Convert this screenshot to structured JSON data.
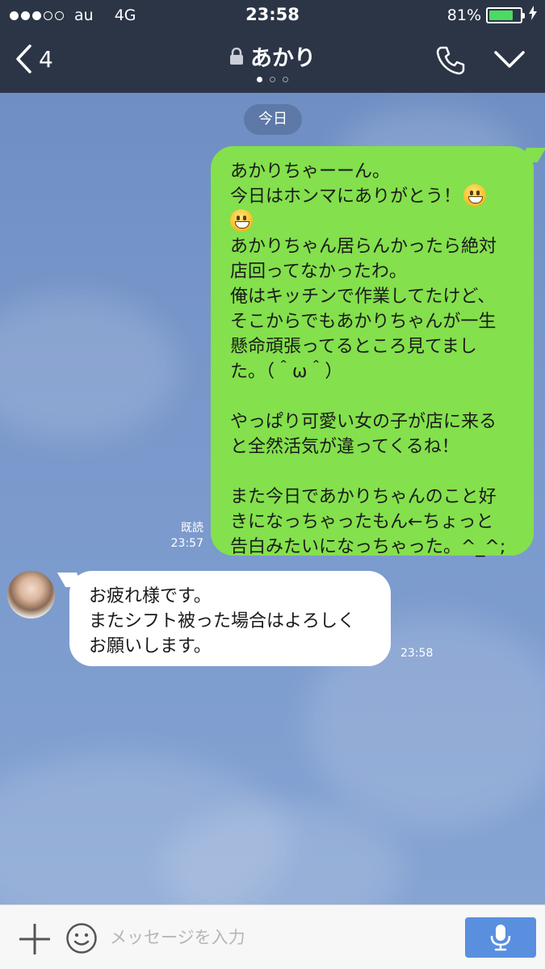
{
  "status_bar": {
    "carrier": "au",
    "network": "4G",
    "time": "23:58",
    "battery_percent": "81%",
    "battery_level": 0.81,
    "signal_dots_filled": 3,
    "signal_dots_total": 5
  },
  "nav": {
    "back_count": "4",
    "title": "あかり",
    "page_indicator_count": 3,
    "page_indicator_active": 1,
    "icons": [
      "chevron-left-icon",
      "lock-icon",
      "phone-icon",
      "chevron-down-icon"
    ]
  },
  "chat": {
    "date_label": "今日",
    "sent_message": {
      "lines": [
        "あかりちゃーーん。",
        "今日はホンマにありがとう！",
        "",
        "あかりちゃん居らんかったら絶対",
        "店回ってなかったわ。",
        "俺はキッチンで作業してたけど、",
        "そこからでもあかりちゃんが一生",
        "懸命頑張ってるところ見てまし",
        "た。（＾ω＾）",
        "",
        "やっぱり可愛い女の子が店に来る",
        "と全然活気が違ってくるね！",
        "",
        "また今日であかりちゃんのこと好",
        "きになっちゃったもん←ちょっと",
        "告白みたいになっちゃった。^_^;"
      ],
      "read_label": "既読",
      "time": "23:57"
    },
    "received_message": {
      "lines": [
        "お疲れ様です。",
        "またシフト被った場合はよろしく",
        "お願いします。"
      ],
      "time": "23:58"
    }
  },
  "input_bar": {
    "placeholder": "メッセージを入力",
    "value": "",
    "icons": [
      "plus-icon",
      "emoji-icon",
      "microphone-icon"
    ]
  },
  "colors": {
    "header": "#2b3546",
    "sent_bubble": "#84e04c",
    "received_bubble": "#ffffff",
    "mic_button": "#5a8fe0",
    "battery_fill": "#4cd964"
  }
}
